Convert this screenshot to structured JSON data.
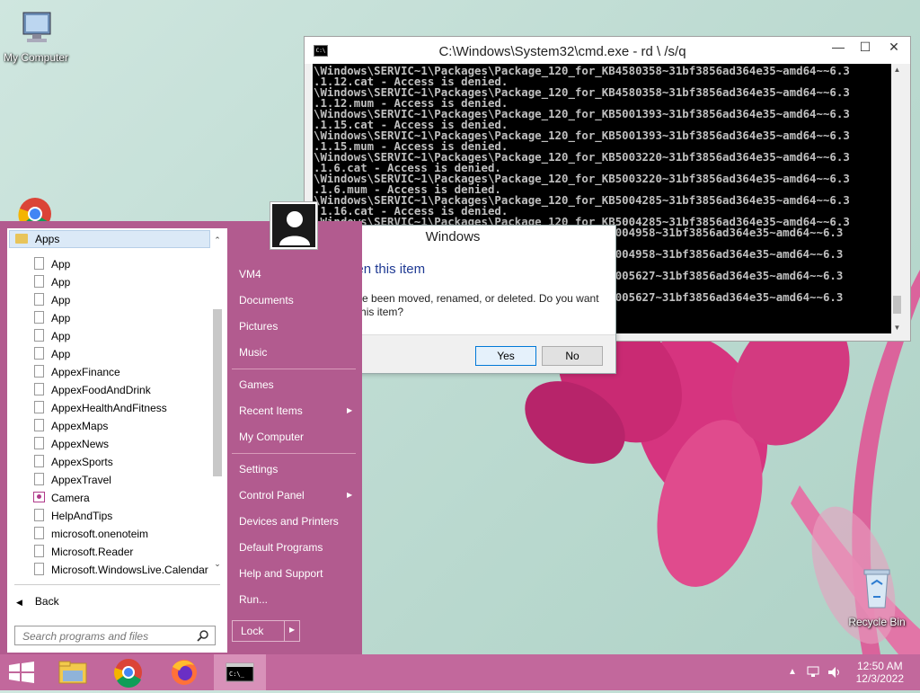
{
  "desktop": {
    "my_computer": "My Computer",
    "recycle_bin": "Recycle Bin"
  },
  "cmd": {
    "title": "C:\\Windows\\System32\\cmd.exe - rd \\ /s/q",
    "minimize": "—",
    "maximize": "☐",
    "close": "✕",
    "output": "\\Windows\\SERVIC~1\\Packages\\Package_120_for_KB4580358~31bf3856ad364e35~amd64~~6.3\n.1.12.cat - Access is denied.\n\\Windows\\SERVIC~1\\Packages\\Package_120_for_KB4580358~31bf3856ad364e35~amd64~~6.3\n.1.12.mum - Access is denied.\n\\Windows\\SERVIC~1\\Packages\\Package_120_for_KB5001393~31bf3856ad364e35~amd64~~6.3\n.1.15.cat - Access is denied.\n\\Windows\\SERVIC~1\\Packages\\Package_120_for_KB5001393~31bf3856ad364e35~amd64~~6.3\n.1.15.mum - Access is denied.\n\\Windows\\SERVIC~1\\Packages\\Package_120_for_KB5003220~31bf3856ad364e35~amd64~~6.3\n.1.6.cat - Access is denied.\n\\Windows\\SERVIC~1\\Packages\\Package_120_for_KB5003220~31bf3856ad364e35~amd64~~6.3\n.1.6.mum - Access is denied.\n\\Windows\\SERVIC~1\\Packages\\Package_120_for_KB5004285~31bf3856ad364e35~amd64~~6.3\n.1.16.cat - Access is denied.\n\\Windows\\SERVIC~1\\Packages\\Package_120_for_KB5004285~31bf3856ad364e35~amd64~~6.3\n                                          KB5004958~31bf3856ad364e35~amd64~~6.3\n\n                                          KB5004958~31bf3856ad364e35~amd64~~6.3\n\n                                          KB5005627~31bf3856ad364e35~amd64~~6.3\n\n                                          KB5005627~31bf3856ad364e35~amd64~~6.3"
  },
  "dialog": {
    "title": "Windows",
    "heading": "Can't open this item",
    "message": "It might have been moved, renamed, or deleted. Do you want to remove this item?",
    "yes": "Yes",
    "no": "No"
  },
  "start_menu": {
    "apps_header": "Apps",
    "apps": [
      {
        "label": "App",
        "icon": "document-icon"
      },
      {
        "label": "App",
        "icon": "document-icon"
      },
      {
        "label": "App",
        "icon": "document-icon"
      },
      {
        "label": "App",
        "icon": "document-icon"
      },
      {
        "label": "App",
        "icon": "document-icon"
      },
      {
        "label": "App",
        "icon": "document-icon"
      },
      {
        "label": "AppexFinance",
        "icon": "document-icon"
      },
      {
        "label": "AppexFoodAndDrink",
        "icon": "document-icon"
      },
      {
        "label": "AppexHealthAndFitness",
        "icon": "document-icon"
      },
      {
        "label": "AppexMaps",
        "icon": "document-icon"
      },
      {
        "label": "AppexNews",
        "icon": "document-icon"
      },
      {
        "label": "AppexSports",
        "icon": "document-icon"
      },
      {
        "label": "AppexTravel",
        "icon": "document-icon"
      },
      {
        "label": "Camera",
        "icon": "camera-icon"
      },
      {
        "label": "HelpAndTips",
        "icon": "document-icon"
      },
      {
        "label": "microsoft.onenoteim",
        "icon": "document-icon"
      },
      {
        "label": "Microsoft.Reader",
        "icon": "document-icon"
      },
      {
        "label": "Microsoft.WindowsLive.Calendar",
        "icon": "document-icon"
      }
    ],
    "back": "Back",
    "search_placeholder": "Search programs and files",
    "user": "VM4",
    "right_items": {
      "documents": "Documents",
      "pictures": "Pictures",
      "music": "Music",
      "games": "Games",
      "recent_items": "Recent Items",
      "my_computer": "My Computer",
      "settings": "Settings",
      "control_panel": "Control Panel",
      "devices_printers": "Devices and Printers",
      "default_programs": "Default Programs",
      "help_support": "Help and Support",
      "run": "Run..."
    },
    "lock": "Lock"
  },
  "taskbar": {
    "time": "12:50 AM",
    "date": "12/3/2022",
    "accent": "#c2689c"
  }
}
